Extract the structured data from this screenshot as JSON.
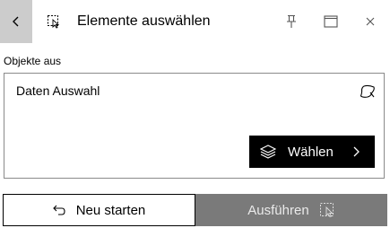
{
  "header": {
    "title": "Elemente auswählen",
    "back_icon": "chevron-left-icon",
    "tool_icon": "select-elements-icon",
    "pin_icon": "pin-icon",
    "maximize_icon": "maximize-icon",
    "close_icon": "close-icon"
  },
  "section": {
    "label": "Objekte aus"
  },
  "selection_box": {
    "label": "Daten Auswahl",
    "freehand_icon": "freehand-select-icon",
    "choose_button": {
      "label": "Wählen",
      "icon": "layers-icon",
      "chevron": "chevron-right-icon"
    }
  },
  "footer": {
    "restart_label": "Neu starten",
    "restart_icon": "undo-arrow-icon",
    "run_label": "Ausführen",
    "run_icon": "select-elements-icon"
  },
  "colors": {
    "back_button_bg": "#cccccc",
    "choose_button_bg": "#000000",
    "run_button_bg": "#7a7a7a",
    "run_button_text": "#eaeaea"
  }
}
